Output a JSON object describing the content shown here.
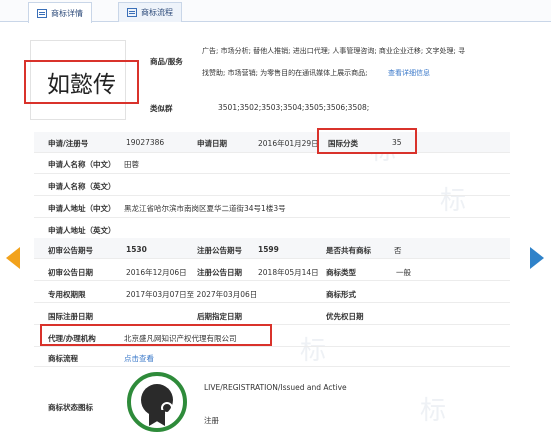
{
  "tabs": [
    {
      "label": "商标详情"
    },
    {
      "label": "商标流程"
    }
  ],
  "trademark": {
    "name": "如懿传",
    "goods_services_label": "商品/服务",
    "goods_services_line1": "广告; 市场分析; 替他人推销; 进出口代理; 人事管理咨询; 商业企业迁移; 文字处理; 寻",
    "goods_services_line2": "找赞助; 市场营销; 为零售目的在通讯媒体上展示商品;",
    "view_detail_link": "查看详细信息",
    "group_label": "类似群",
    "group_value": "3501;3502;3503;3504;3505;3506;3508;"
  },
  "fields": {
    "reg_no_label": "申请/注册号",
    "reg_no": "19027386",
    "app_date_label": "申请日期",
    "app_date": "2016年01月29日",
    "intl_class_label": "国际分类",
    "intl_class": "35",
    "applicant_cn_label": "申请人名称（中文）",
    "applicant_cn": "田蓉",
    "applicant_en_label": "申请人名称（英文）",
    "address_cn_label": "申请人地址（中文）",
    "address_cn": "黑龙江省哈尔滨市南岗区夏华二道街34号1楼3号",
    "address_en_label": "申请人地址（英文）",
    "prelim_no_label": "初审公告期号",
    "prelim_no": "1530",
    "reg_pub_no_label": "注册公告期号",
    "reg_pub_no": "1599",
    "shared_label": "是否共有商标",
    "shared": "否",
    "prelim_date_label": "初审公告日期",
    "prelim_date": "2016年12月06日",
    "reg_pub_date_label": "注册公告日期",
    "reg_pub_date": "2018年05月14日",
    "type_label": "商标类型",
    "type": "一般",
    "exclusive_label": "专用权期限",
    "exclusive": "2017年03月07日至 2027年03月06日",
    "form_label": "商标形式",
    "intl_reg_date_label": "国际注册日期",
    "later_date_label": "后期指定日期",
    "priority_label": "优先权日期",
    "agent_label": "代理/办理机构",
    "agent": "北京盛凡网知识产权代理有限公司",
    "flow_label": "商标流程",
    "flow_link": "点击查看",
    "status_label": "商标状态图标",
    "status_en": "LIVE/REGISTRATION/Issued and Active",
    "status_cn": "注册"
  },
  "watermark": "标",
  "colors": {
    "highlight": "#d9322b",
    "link": "#3a78c9",
    "prev_arrow": "#f2a21c",
    "next_arrow": "#2f82c9",
    "seal": "#2e8b3a"
  }
}
